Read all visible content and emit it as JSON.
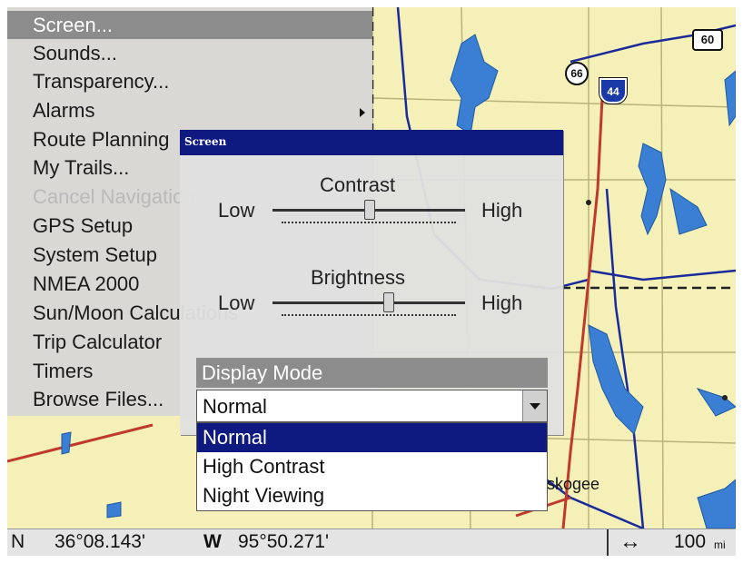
{
  "menu": {
    "items": [
      {
        "label": "Screen...",
        "state": "selected"
      },
      {
        "label": "Sounds...",
        "state": "normal"
      },
      {
        "label": "Transparency...",
        "state": "normal"
      },
      {
        "label": "Alarms",
        "state": "normal",
        "submenu": true
      },
      {
        "label": "Route Planning",
        "state": "normal"
      },
      {
        "label": "My Trails...",
        "state": "normal"
      },
      {
        "label": "Cancel Navigation",
        "state": "disabled"
      },
      {
        "label": "GPS Setup",
        "state": "normal"
      },
      {
        "label": "System Setup",
        "state": "normal"
      },
      {
        "label": "NMEA 2000",
        "state": "normal"
      },
      {
        "label": "Sun/Moon Calculations",
        "state": "normal"
      },
      {
        "label": "Trip Calculator",
        "state": "normal"
      },
      {
        "label": "Timers",
        "state": "normal"
      },
      {
        "label": "Browse Files...",
        "state": "normal"
      }
    ]
  },
  "dialog": {
    "title": "Screen",
    "contrast": {
      "label": "Contrast",
      "low": "Low",
      "high": "High",
      "level": 0.5
    },
    "brightness": {
      "label": "Brightness",
      "low": "Low",
      "high": "High",
      "level": 0.6
    },
    "display_mode": {
      "label": "Display Mode",
      "value": "Normal",
      "options": [
        "Normal",
        "High Contrast",
        "Night Viewing"
      ],
      "selected_index": 0
    }
  },
  "map": {
    "route_shields": [
      "60",
      "66",
      "44"
    ],
    "place_label": "skogee"
  },
  "status": {
    "lat_hemisphere": "N",
    "lat_value": "36°08.143'",
    "lon_hemisphere": "W",
    "lon_value": "95°50.271'",
    "scale_icon": "horizontal-double-arrow-icon",
    "scale_value": "100",
    "scale_unit": "mi"
  },
  "colors": {
    "title_bar": "#0f1a80",
    "menu_highlight": "#8c8c8c",
    "map_land": "#f4f0b8",
    "water": "#3a7fd4",
    "highway": "#c0392b",
    "road": "#1a2a9a"
  }
}
